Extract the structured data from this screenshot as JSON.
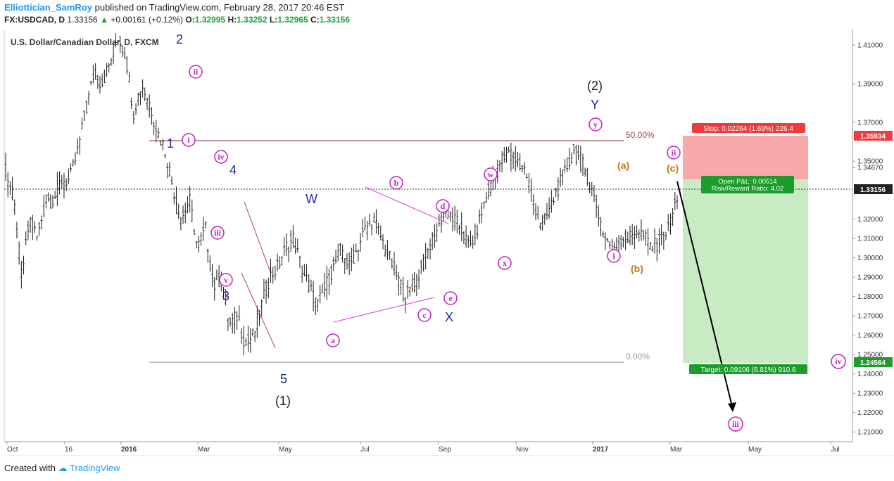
{
  "header": {
    "author": "Elliottician_SamRoy",
    "published": "published on TradingView.com, February 28, 2017 20:46 EST",
    "symbol_line": "FX:USDCAD, D",
    "last": "1.33156",
    "change": "+0.00161 (+0.12%)",
    "o_label": "O:",
    "o_value": "1.32995",
    "h_label": "H:",
    "h_value": "1.33252",
    "l_label": "L:",
    "l_value": "1.32965",
    "c_label": "C:",
    "c_value": "1.33156"
  },
  "footer": {
    "created_with": "Created with",
    "brand": "TradingView"
  },
  "chart_data": {
    "type": "ohlc",
    "title": "U.S. Dollar/Canadian Dollar, D, FXCM",
    "ylim": [
      1.205,
      1.418
    ],
    "y_ticks": [
      "1.41000",
      "1.39000",
      "1.37000",
      "1.35000",
      "1.34670",
      "1.32000",
      "1.31000",
      "1.30000",
      "1.29000",
      "1.28000",
      "1.27000",
      "1.26000",
      "1.25000",
      "1.24000",
      "1.23000",
      "1.22000",
      "1.21000"
    ],
    "x_ticks": [
      "Oct",
      "16",
      "2016",
      "Mar",
      "May",
      "Jul",
      "Sep",
      "Nov",
      "2017",
      "Mar",
      "May",
      "Jul"
    ],
    "price_tags": {
      "stop_price": "1.35934",
      "current_price": "1.33156",
      "target_price": "1.24564"
    },
    "fib_levels": [
      {
        "label": "50.00%",
        "value": 1.3566
      },
      {
        "label": "0.00%",
        "value": 1.2461
      }
    ],
    "series_path": [
      [
        1.345,
        1.33,
        1.345
      ],
      [
        1.33,
        1.3,
        1.33
      ],
      [
        1.3,
        1.285,
        1.29
      ],
      [
        1.29,
        1.325,
        1.32
      ],
      [
        1.32,
        1.3,
        1.31
      ],
      [
        1.31,
        1.335,
        1.33
      ],
      [
        1.33,
        1.32,
        1.33
      ],
      [
        1.33,
        1.345,
        1.34
      ],
      [
        1.34,
        1.33,
        1.34
      ],
      [
        1.34,
        1.36,
        1.355
      ],
      [
        1.355,
        1.38,
        1.375
      ],
      [
        1.375,
        1.4,
        1.395
      ],
      [
        1.395,
        1.385,
        1.39
      ],
      [
        1.39,
        1.405,
        1.4
      ],
      [
        1.4,
        1.418,
        1.415
      ],
      [
        1.415,
        1.4,
        1.405
      ],
      [
        1.405,
        1.37,
        1.375
      ],
      [
        1.375,
        1.395,
        1.39
      ],
      [
        1.39,
        1.37,
        1.38
      ],
      [
        1.38,
        1.36,
        1.365
      ],
      [
        1.365,
        1.35,
        1.355
      ],
      [
        1.355,
        1.33,
        1.335
      ],
      [
        1.335,
        1.32,
        1.32
      ],
      [
        1.32,
        1.34,
        1.33
      ],
      [
        1.33,
        1.3,
        1.305
      ],
      [
        1.305,
        1.32,
        1.315
      ],
      [
        1.315,
        1.28,
        1.285
      ],
      [
        1.285,
        1.3,
        1.29
      ],
      [
        1.29,
        1.26,
        1.265
      ],
      [
        1.265,
        1.275,
        1.27
      ],
      [
        1.27,
        1.25,
        1.255
      ],
      [
        1.255,
        1.265,
        1.26
      ],
      [
        1.26,
        1.28,
        1.275
      ],
      [
        1.275,
        1.295,
        1.29
      ],
      [
        1.29,
        1.3,
        1.295
      ],
      [
        1.295,
        1.31,
        1.305
      ],
      [
        1.305,
        1.315,
        1.31
      ],
      [
        1.31,
        1.29,
        1.295
      ],
      [
        1.295,
        1.28,
        1.285
      ],
      [
        1.285,
        1.27,
        1.275
      ],
      [
        1.275,
        1.29,
        1.285
      ],
      [
        1.285,
        1.3,
        1.295
      ],
      [
        1.295,
        1.31,
        1.305
      ],
      [
        1.305,
        1.29,
        1.295
      ],
      [
        1.295,
        1.31,
        1.305
      ],
      [
        1.305,
        1.32,
        1.315
      ],
      [
        1.315,
        1.325,
        1.32
      ],
      [
        1.32,
        1.305,
        1.31
      ],
      [
        1.31,
        1.295,
        1.3
      ],
      [
        1.3,
        1.285,
        1.29
      ],
      [
        1.29,
        1.278,
        1.28
      ],
      [
        1.28,
        1.29,
        1.285
      ],
      [
        1.285,
        1.3,
        1.295
      ],
      [
        1.295,
        1.31,
        1.305
      ],
      [
        1.305,
        1.32,
        1.315
      ],
      [
        1.315,
        1.33,
        1.325
      ],
      [
        1.325,
        1.315,
        1.32
      ],
      [
        1.32,
        1.31,
        1.315
      ],
      [
        1.315,
        1.3,
        1.305
      ],
      [
        1.305,
        1.32,
        1.315
      ],
      [
        1.315,
        1.335,
        1.33
      ],
      [
        1.33,
        1.345,
        1.34
      ],
      [
        1.34,
        1.355,
        1.35
      ],
      [
        1.35,
        1.36,
        1.355
      ],
      [
        1.355,
        1.345,
        1.35
      ],
      [
        1.35,
        1.34,
        1.345
      ],
      [
        1.345,
        1.325,
        1.33
      ],
      [
        1.33,
        1.31,
        1.315
      ],
      [
        1.315,
        1.33,
        1.325
      ],
      [
        1.325,
        1.34,
        1.335
      ],
      [
        1.335,
        1.35,
        1.345
      ],
      [
        1.345,
        1.36,
        1.355
      ],
      [
        1.355,
        1.345,
        1.35
      ],
      [
        1.35,
        1.335,
        1.34
      ],
      [
        1.34,
        1.32,
        1.325
      ],
      [
        1.325,
        1.305,
        1.31
      ],
      [
        1.31,
        1.3,
        1.305
      ],
      [
        1.305,
        1.31,
        1.31
      ],
      [
        1.31,
        1.305,
        1.31
      ],
      [
        1.31,
        1.32,
        1.315
      ],
      [
        1.315,
        1.305,
        1.31
      ],
      [
        1.31,
        1.3,
        1.305
      ],
      [
        1.305,
        1.315,
        1.31
      ],
      [
        1.31,
        1.32,
        1.315
      ],
      [
        1.315,
        1.336,
        1.332
      ]
    ]
  },
  "annotations": {
    "wave_2": "2",
    "wave_1": "1",
    "wave_3": "3",
    "wave_4": "4",
    "wave_5": "5",
    "wave_W": "W",
    "wave_X": "X",
    "wave_Y": "Y",
    "big_1": "(1)",
    "big_2": "(2)",
    "circ_ii_top": "ii",
    "circ_i_left": "i",
    "circ_iv_left": "iv",
    "circ_iii_left": "iii",
    "circ_v": "v",
    "circ_a": "a",
    "circ_b": "b",
    "circ_c": "c",
    "circ_d": "d",
    "circ_e": "e",
    "circ_w": "w",
    "circ_x": "x",
    "circ_y": "y",
    "circ_i_right": "i",
    "circ_ii_right": "ii",
    "circ_iii_bottom": "iii",
    "circ_iv_right": "iv",
    "brown_a": "(a)",
    "brown_b": "(b)",
    "brown_c": "(c)",
    "stop_box": "Stop: 0.02264 (1.69%) 226.4",
    "pnl_line1": "Open P&L: 0.00514",
    "pnl_line2": "Risk/Reward Ratio: 4.02",
    "target_box": "Target: 0.09106 (6.81%) 910.6"
  },
  "colors": {
    "stop_zone": "#f8aaaa",
    "profit_zone": "#c8ebc4",
    "stop_box": "#ef3b3b",
    "green_box": "#1c9c2a",
    "elliott_magenta": "#c020c0",
    "elliott_blue": "#1e2a9a",
    "elliott_brown": "#c07a10"
  }
}
